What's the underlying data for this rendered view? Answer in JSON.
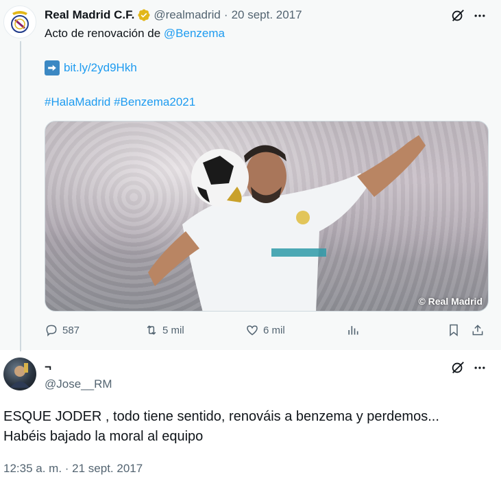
{
  "tweet": {
    "author_name": "Real Madrid C.F.",
    "handle": "@realmadrid",
    "separator": "·",
    "date": "20 sept. 2017",
    "text_line1_prefix": "Acto de renovación de ",
    "mention": "@Benzema",
    "link": "bit.ly/2yd9Hkh",
    "hashtags": "#HalaMadrid #Benzema2021",
    "media_watermark": "© Real Madrid",
    "stats": {
      "replies": "587",
      "retweets": "5 mil",
      "likes": "6 mil"
    },
    "icons": [
      "verified-badge-icon",
      "grok-icon",
      "more-icon",
      "reply-icon",
      "retweet-icon",
      "like-icon",
      "views-icon",
      "bookmark-icon",
      "share-icon",
      "right-arrow-emoji-icon"
    ]
  },
  "reply": {
    "author_name": "¬",
    "handle": "@Jose__RM",
    "text_line1": "ESQUE JODER , todo tiene sentido, renováis a benzema y perdemos...",
    "text_line2": "Habéis bajado la moral al equipo",
    "timestamp": "12:35 a. m. · 21 sept. 2017"
  },
  "colors": {
    "accent": "#1d9bf0",
    "secondary_text": "#536471",
    "primary_text": "#0f1419",
    "verified_gold": "#e2b719",
    "parent_background": "#f7f9f9"
  }
}
